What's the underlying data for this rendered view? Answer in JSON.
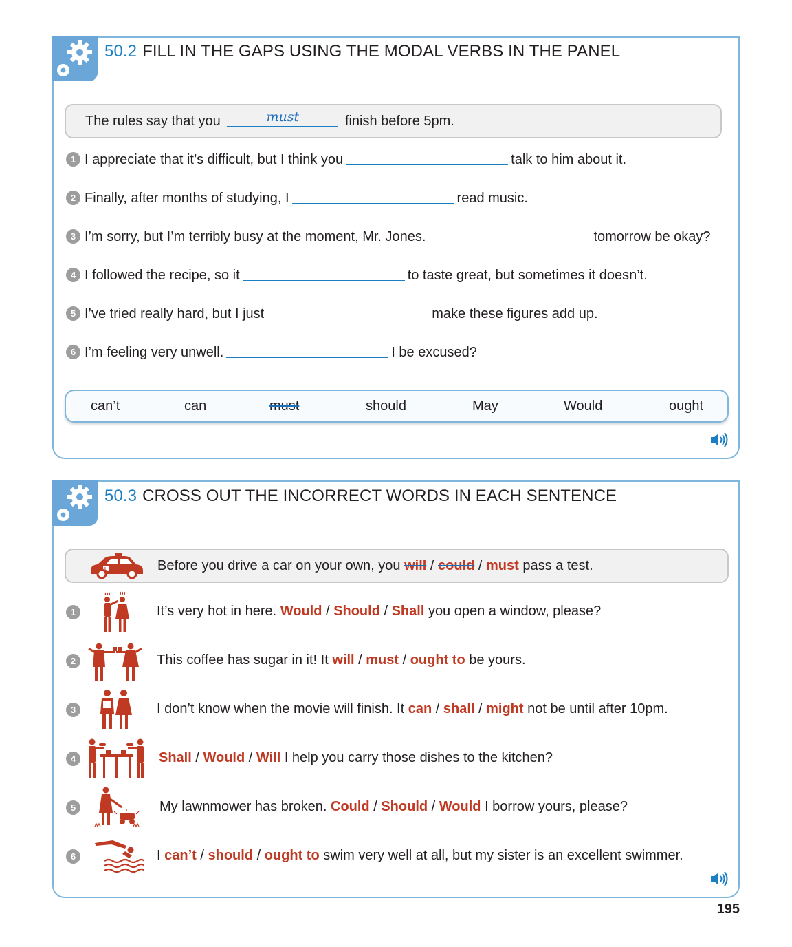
{
  "section1": {
    "number": "50.2",
    "title": "FILL IN THE GAPS USING THE MODAL VERBS IN THE PANEL",
    "example": {
      "before": "The rules say that you",
      "answer": "must",
      "after": "finish before 5pm."
    },
    "items": [
      {
        "n": "1",
        "before": "I appreciate that it’s difficult, but I think you",
        "after": "talk to him about it."
      },
      {
        "n": "2",
        "before": "Finally, after months of studying, I",
        "after": "read music."
      },
      {
        "n": "3",
        "before": "I’m sorry, but I’m terribly busy at the moment, Mr. Jones.",
        "after": "tomorrow be okay?"
      },
      {
        "n": "4",
        "before": "I followed the recipe, so it",
        "after": "to taste great, but sometimes it doesn’t."
      },
      {
        "n": "5",
        "before": "I’ve tried really hard, but I just",
        "after": "make these figures add up."
      },
      {
        "n": "6",
        "before": "I’m feeling very unwell.",
        "after": "I be excused?"
      }
    ],
    "panel_words": [
      "can’t",
      "can",
      "must",
      "should",
      "May",
      "Would",
      "ought"
    ]
  },
  "section2": {
    "number": "50.3",
    "title": "CROSS OUT THE INCORRECT WORDS IN EACH SENTENCE",
    "example": {
      "before": "Before you drive a car on your own, you",
      "options": [
        "will",
        "could",
        "must"
      ],
      "after": "pass a test."
    },
    "items": [
      {
        "n": "1",
        "before": "It’s very hot in here.",
        "options": [
          "Would",
          "Should",
          "Shall"
        ],
        "after": "you open a window, please?",
        "icon": "hot-people-icon"
      },
      {
        "n": "2",
        "before": "This coffee has sugar in it! It",
        "options": [
          "will",
          "must",
          "ought to"
        ],
        "after": "be yours.",
        "icon": "coffee-people-icon"
      },
      {
        "n": "3",
        "before": "I don’t know when the movie will finish. It",
        "options": [
          "can",
          "shall",
          "might"
        ],
        "after": "not be until after 10pm.",
        "icon": "couple-icon"
      },
      {
        "n": "4",
        "before": "",
        "options": [
          "Shall",
          "Would",
          "Will"
        ],
        "after": "I help you carry those dishes to the kitchen?",
        "icon": "dishes-table-icon"
      },
      {
        "n": "5",
        "before": "My lawnmower has broken.",
        "options": [
          "Could",
          "Should",
          "Would"
        ],
        "after": "I borrow yours, please?",
        "icon": "lawnmower-icon"
      },
      {
        "n": "6",
        "before": "I",
        "options": [
          "can’t",
          "should",
          "ought to"
        ],
        "after": "swim very well at all, but my sister is an excellent swimmer.",
        "icon": "swimmer-icon"
      }
    ]
  },
  "page_number": "195",
  "colors": {
    "accent_blue": "#1c7fc4",
    "border_blue": "#7fb6dd",
    "answer_red": "#c03a23",
    "bullet_grey": "#9d9d9d"
  }
}
